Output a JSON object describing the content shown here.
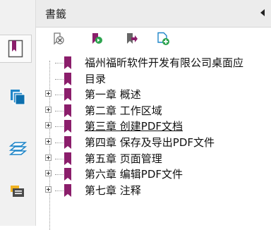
{
  "panel": {
    "title": "書籤"
  },
  "toolbar": {
    "tools": [
      {
        "icon": "delete-bookmark-icon"
      },
      {
        "icon": "expand-bookmark-icon"
      },
      {
        "icon": "go-to-bookmark-icon"
      },
      {
        "icon": "add-bookmark-icon"
      }
    ]
  },
  "rail": {
    "buttons": [
      {
        "icon": "bookmarks-icon",
        "active": true
      },
      {
        "icon": "pages-icon"
      },
      {
        "icon": "layers-icon"
      },
      {
        "icon": "comments-icon"
      }
    ]
  },
  "bookmarks": [
    {
      "label": "福州福昕软件开发有限公司桌面应",
      "expandable": false
    },
    {
      "label": "目录",
      "expandable": false
    },
    {
      "label": "第一章 概述",
      "expandable": true
    },
    {
      "label": "第二章 工作区域",
      "expandable": true
    },
    {
      "label": "第三章 创建PDF文档",
      "expandable": true,
      "underlined": true
    },
    {
      "label": "第四章 保存及导出PDF文件",
      "expandable": true
    },
    {
      "label": "第五章 页面管理",
      "expandable": true
    },
    {
      "label": "第六章 编辑PDF文件",
      "expandable": true
    },
    {
      "label": "第七章 注释",
      "expandable": true
    }
  ],
  "colors": {
    "bookmark": "#8b1e6b",
    "accent_blue": "#1f86c9",
    "accent_yellow": "#f0b323",
    "accent_green": "#2ea44f"
  }
}
